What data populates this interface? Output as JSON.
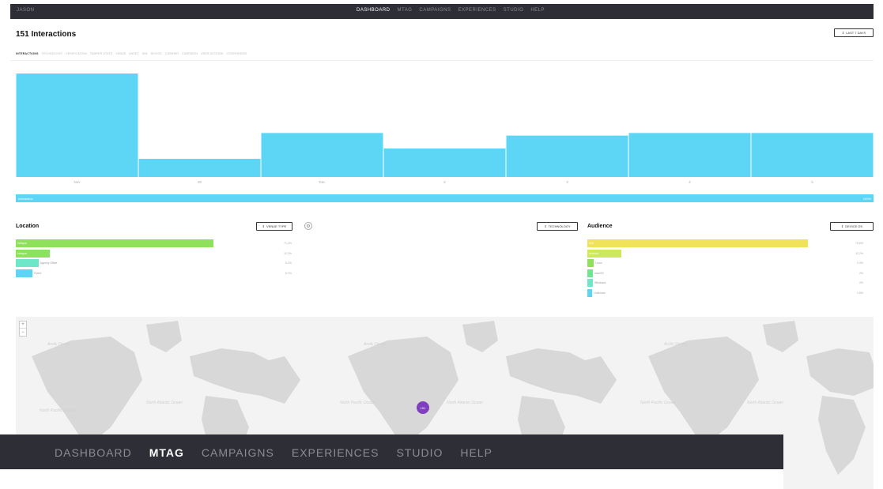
{
  "topnav": {
    "brand": "JASON",
    "links": [
      "DASHBOARD",
      "MTAG",
      "CAMPAIGNS",
      "EXPERIENCES",
      "STUDIO",
      "HELP"
    ],
    "active": "DASHBOARD"
  },
  "header": {
    "title": "151 Interactions",
    "range_button": "LAST 7 DAYS"
  },
  "tabs": [
    "INTERACTIONS",
    "TECHNOLOGY",
    "VERIFICATION",
    "TAMPER STATE",
    "VENUE",
    "ASSET",
    "SIM",
    "DEVICE",
    "CARRIER",
    "CAMPAIGN",
    "USER ACTIONS",
    "CONVERSION"
  ],
  "active_tab": "INTERACTIONS",
  "chart_data": {
    "type": "bar",
    "categories": [
      "Nov",
      "30",
      "Dec",
      "2",
      "3",
      "4",
      "5"
    ],
    "values": [
      40,
      7,
      17,
      11,
      16,
      17,
      17
    ],
    "ylim": [
      0,
      44
    ],
    "color": "#5dd5f5",
    "grid": false
  },
  "full_bar": {
    "label": "Interaction",
    "value": "100%"
  },
  "location": {
    "title": "Location",
    "select_label": "VENUE TYPE",
    "rows": [
      {
        "label": "Hotspot",
        "pct": 71.4,
        "pct_text": "71.4%",
        "color": "#8fe05a"
      },
      {
        "label": "Hotspot",
        "pct": 12.2,
        "pct_text": "12.2%",
        "color": "#8fe05a"
      },
      {
        "label": "Agency Office",
        "pct": 8.2,
        "pct_text": "8.2%",
        "color": "#6ee6c8"
      },
      {
        "label": "Event",
        "pct": 6.1,
        "pct_text": "6.1%",
        "color": "#5dd5f5"
      }
    ]
  },
  "technology": {
    "select_label": "TECHNOLOGY"
  },
  "audience": {
    "title": "Audience",
    "select_label": "DEVICE OS",
    "rows": [
      {
        "label": "iOS",
        "pct": 79.6,
        "pct_text": "79.6%",
        "color": "#f0e35a"
      },
      {
        "label": "Android",
        "pct": 12.2,
        "pct_text": "12.2%",
        "color": "#cde85a"
      },
      {
        "label": "Linux",
        "pct": 2.4,
        "pct_text": "2.4%",
        "color": "#8fe05a"
      },
      {
        "label": "macOS",
        "pct": 2.0,
        "pct_text": "2%",
        "color": "#6ee68f"
      },
      {
        "label": "Windows",
        "pct": 2.0,
        "pct_text": "2%",
        "color": "#6ee6c8"
      },
      {
        "label": "Unknown",
        "pct": 1.8,
        "pct_text": "1.8%",
        "color": "#5dd5f5"
      }
    ]
  },
  "map": {
    "zoom_in": "+",
    "zoom_out": "−",
    "marker_count": "151"
  },
  "zoom_nav": {
    "links": [
      "DASHBOARD",
      "MTAG",
      "CAMPAIGNS",
      "EXPERIENCES",
      "STUDIO",
      "HELP"
    ],
    "active": "MTAG"
  }
}
